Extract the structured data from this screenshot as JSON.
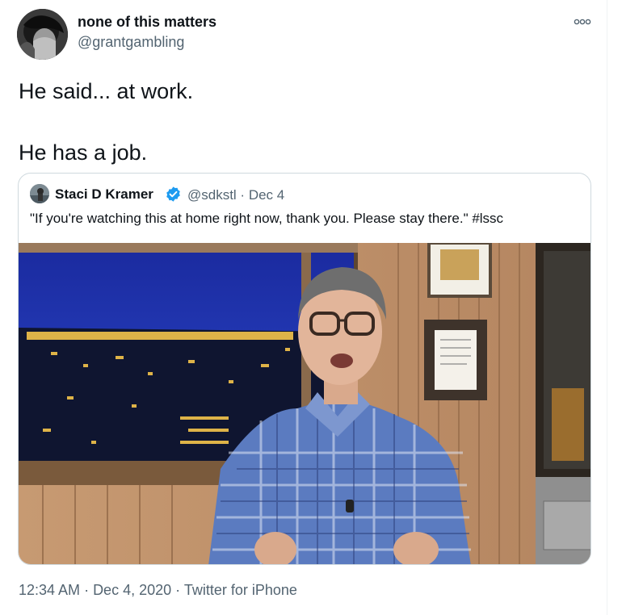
{
  "tweet": {
    "display_name": "none of this matters",
    "handle": "@grantgambling",
    "text": "He said... at work.\n\nHe has a job.",
    "more_icon": "more-dots-icon"
  },
  "quoted_tweet": {
    "display_name": "Staci D Kramer",
    "verified": true,
    "handle_and_date": "@sdkstl · Dec 4",
    "text": "\"If you're watching this at home right now, thank you. Please stay there.\" #lssc",
    "media_icon": "video-still"
  },
  "meta": {
    "time": "12:34 AM",
    "date": "Dec 4, 2020",
    "source": "Twitter for iPhone",
    "separator": " · "
  },
  "colors": {
    "text_primary": "#0f1419",
    "text_secondary": "#536471",
    "border": "#cfd9de",
    "verified": "#1d9bf0"
  }
}
